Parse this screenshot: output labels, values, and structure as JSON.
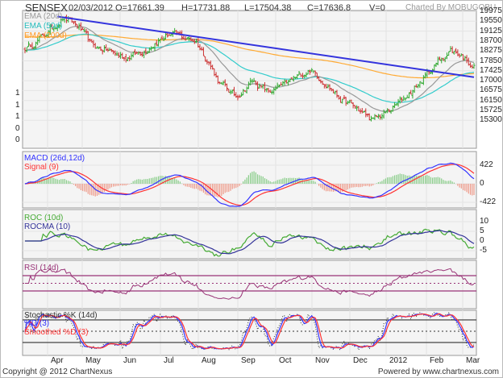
{
  "header": {
    "symbol": "SENSEX",
    "date": "02/03/2012",
    "open": "O=17661.39",
    "high": "H=17731.88",
    "low": "L=17504.38",
    "close": "C=17636.8",
    "volume": "V=0",
    "credit": "Charted By MOBUGOBU"
  },
  "legends": {
    "ema20": "EMA (20d)",
    "ema50": "EMA (50d)",
    "ema200": "EMA (200d)",
    "macd": "MACD (26d,12d)",
    "signal": "Signal (9)",
    "roc": "ROC (10d)",
    "rocma": "ROCMA (10)",
    "rsi": "RSI (14d)",
    "stoch_k": "Stochastic %K (14d)",
    "stoch_d": "%D (3)",
    "stoch_sd": "Smoothed %D (3)"
  },
  "price_ticks": [
    "19975",
    "19550",
    "19125",
    "18700",
    "18275",
    "17850",
    "17425",
    "17000",
    "16575",
    "16150",
    "15725",
    "15300"
  ],
  "left_ticks": [
    "1",
    "1",
    "1",
    "0",
    "0"
  ],
  "macd_ticks": [
    "422",
    "0",
    "-422"
  ],
  "roc_ticks": [
    "10",
    "5",
    "0",
    "-5"
  ],
  "months": [
    "Apr",
    "May",
    "Jun",
    "Jul",
    "Aug",
    "Sep",
    "Oct",
    "Nov",
    "Dec",
    "2012",
    "Feb",
    "Mar"
  ],
  "footer": {
    "copyright": "Copyright @ 2012 ChartNexus",
    "powered": "Powered by www.chartnexus.com"
  },
  "colors": {
    "up": "#33aa33",
    "down": "#cc3333",
    "ema20": "#999999",
    "ema50": "#33cccc",
    "ema200": "#ffaa33",
    "trend": "#3333dd",
    "macd": "#3333ff",
    "signal": "#ff3333",
    "roc": "#44aa33",
    "rocma": "#333399",
    "rsi": "#993377"
  },
  "chart_data": {
    "type": "ohlc",
    "title": "SENSEX",
    "days": 250,
    "ylim": [
      15300,
      19975
    ],
    "close_keypoints": [
      [
        1,
        18400
      ],
      [
        10,
        18900
      ],
      [
        21,
        19700
      ],
      [
        30,
        19300
      ],
      [
        37,
        18500
      ],
      [
        46,
        18300
      ],
      [
        55,
        18000
      ],
      [
        64,
        18200
      ],
      [
        73,
        18700
      ],
      [
        80,
        19000
      ],
      [
        95,
        18700
      ],
      [
        102,
        17800
      ],
      [
        108,
        16900
      ],
      [
        117,
        16300
      ],
      [
        126,
        17000
      ],
      [
        135,
        16500
      ],
      [
        144,
        16800
      ],
      [
        158,
        17500
      ],
      [
        167,
        16900
      ],
      [
        175,
        16200
      ],
      [
        184,
        15800
      ],
      [
        193,
        15300
      ],
      [
        202,
        15700
      ],
      [
        211,
        16300
      ],
      [
        220,
        17000
      ],
      [
        229,
        17800
      ],
      [
        236,
        18300
      ],
      [
        242,
        18100
      ],
      [
        249,
        17637
      ]
    ],
    "trendline": [
      [
        18,
        19750
      ],
      [
        249,
        17150
      ]
    ],
    "indicators": {
      "macd_range": [
        -422,
        422
      ],
      "roc_range": [
        -5,
        10
      ],
      "rsi_bands": [
        30,
        50,
        70
      ],
      "stoch_bands": [
        20,
        50,
        80
      ]
    }
  }
}
